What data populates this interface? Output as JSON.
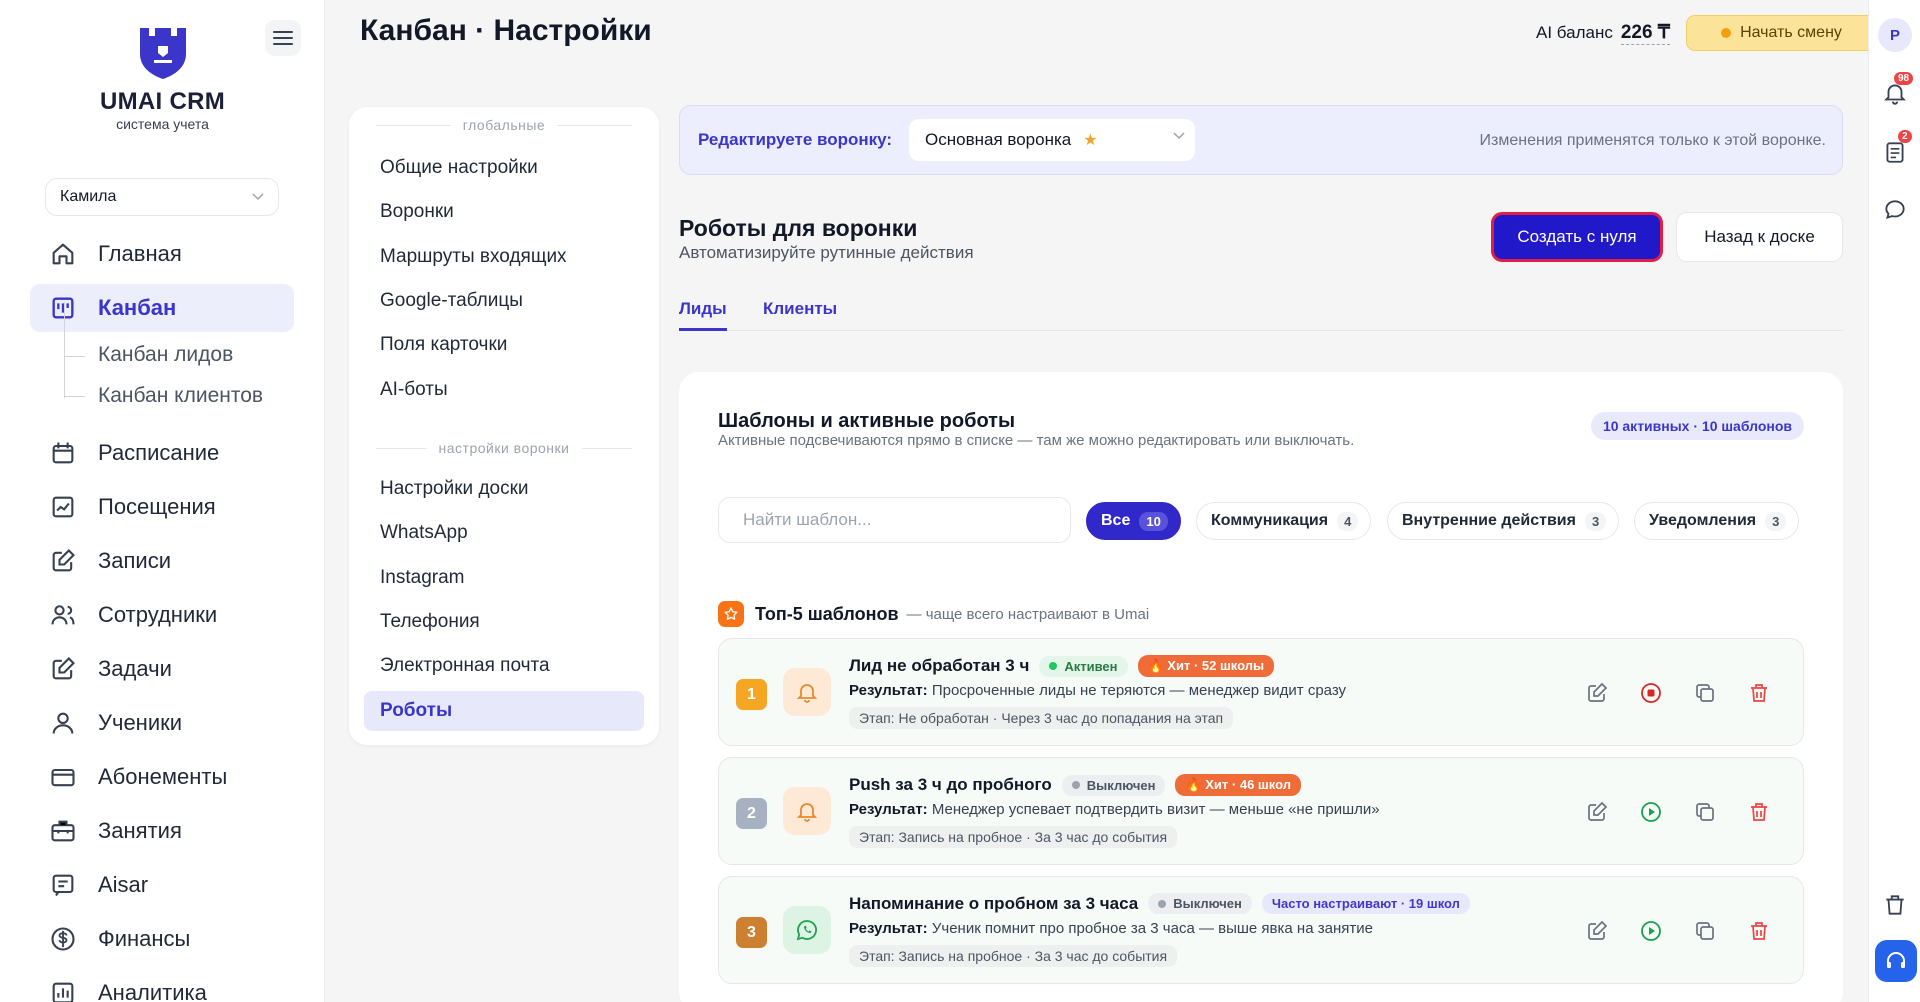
{
  "brand": {
    "name": "UMAI CRM",
    "tagline": "система учета"
  },
  "user_select": {
    "value": "Камила"
  },
  "nav": [
    {
      "label": "Главная",
      "icon": "home-icon"
    },
    {
      "label": "Канбан",
      "icon": "kanban-icon",
      "active": true
    },
    {
      "label": "Расписание",
      "icon": "calendar-icon"
    },
    {
      "label": "Посещения",
      "icon": "chart-square-icon"
    },
    {
      "label": "Записи",
      "icon": "edit-icon"
    },
    {
      "label": "Сотрудники",
      "icon": "users-icon"
    },
    {
      "label": "Задачи",
      "icon": "task-icon"
    },
    {
      "label": "Ученики",
      "icon": "user-icon"
    },
    {
      "label": "Абонементы",
      "icon": "card-icon"
    },
    {
      "label": "Занятия",
      "icon": "briefcase-icon"
    },
    {
      "label": "Aisar",
      "icon": "message-icon"
    },
    {
      "label": "Финансы",
      "icon": "dollar-icon"
    },
    {
      "label": "Аналитика",
      "icon": "analytics-icon"
    }
  ],
  "subnav": [
    "Канбан лидов",
    "Канбан клиентов"
  ],
  "header": {
    "title": "Канбан · Настройки",
    "ai_balance_label": "AI баланс",
    "ai_balance_value": "226 ₸",
    "shift_button": "Начать смену"
  },
  "rail": {
    "avatar": "P",
    "notifications_count": "98",
    "tasks_count": "2"
  },
  "settings_menu": {
    "global_label": "глобальные",
    "global_items": [
      "Общие настройки",
      "Воронки",
      "Маршруты входящих",
      "Google-таблицы",
      "Поля карточки",
      "AI-боты"
    ],
    "funnel_label": "настройки воронки",
    "funnel_items": [
      "Настройки доски",
      "WhatsApp",
      "Instagram",
      "Телефония",
      "Электронная почта",
      "Роботы"
    ],
    "active": "Роботы"
  },
  "funnel_bar": {
    "label": "Редактируете воронку:",
    "selected": "Основная воронка",
    "note": "Изменения применятся только к этой воронке."
  },
  "robots": {
    "title": "Роботы для воронки",
    "subtitle": "Автоматизируйте рутинные действия",
    "create_button": "Создать с нуля",
    "back_button": "Назад к доске",
    "tabs": [
      {
        "label": "Лиды",
        "active": true
      },
      {
        "label": "Клиенты",
        "active": false
      }
    ]
  },
  "templates": {
    "title": "Шаблоны и активные роботы",
    "subtitle": "Активные подсвечиваются прямо в списке — там же можно редактировать или выключать.",
    "counter": "10 активных · 10 шаблонов",
    "search_placeholder": "Найти шаблон...",
    "filters": [
      {
        "label": "Все",
        "count": "10",
        "active": true
      },
      {
        "label": "Коммуникация",
        "count": "4"
      },
      {
        "label": "Внутренние действия",
        "count": "3"
      },
      {
        "label": "Уведомления",
        "count": "3"
      }
    ],
    "top5_title": "Топ-5 шаблонов",
    "top5_sub": "— чаще всего настраивают в Umai",
    "result_label": "Результат:",
    "items": [
      {
        "rank": "1",
        "rank_color": "#f5a623",
        "icon": "bell-icon",
        "icon_bg": "#fde9d6",
        "icon_color": "#e58a2c",
        "name": "Лид не обработан 3 ч",
        "status": "Активен",
        "status_kind": "on",
        "tag": "🔥 Хит · 52 школы",
        "tag_kind": "hit",
        "result": "Просроченные лиды не теряются — менеджер видит сразу",
        "stage": "Этап: Не обработан · Через 3 час до попадания на этап",
        "toggle": "stop"
      },
      {
        "rank": "2",
        "rank_color": "#a8b1c2",
        "icon": "bell-icon",
        "icon_bg": "#fde9d6",
        "icon_color": "#e58a2c",
        "name": "Push за 3 ч до пробного",
        "status": "Выключен",
        "status_kind": "off",
        "tag": "🔥 Хит · 46 школ",
        "tag_kind": "hit",
        "result": "Менеджер успевает подтвердить визит — меньше «не пришли»",
        "stage": "Этап: Запись на пробное · За 3 час до события",
        "toggle": "play"
      },
      {
        "rank": "3",
        "rank_color": "#cd7f32",
        "icon": "whatsapp-icon",
        "icon_bg": "#ddf3e3",
        "icon_color": "#22a150",
        "name": "Напоминание о пробном за 3 часа",
        "status": "Выключен",
        "status_kind": "off",
        "tag": "Часто настраивают · 19 школ",
        "tag_kind": "freq",
        "result": "Ученик помнит про пробное за 3 часа — выше явка на занятие",
        "stage": "Этап: Запись на пробное · За 3 час до события",
        "toggle": "play"
      }
    ]
  }
}
